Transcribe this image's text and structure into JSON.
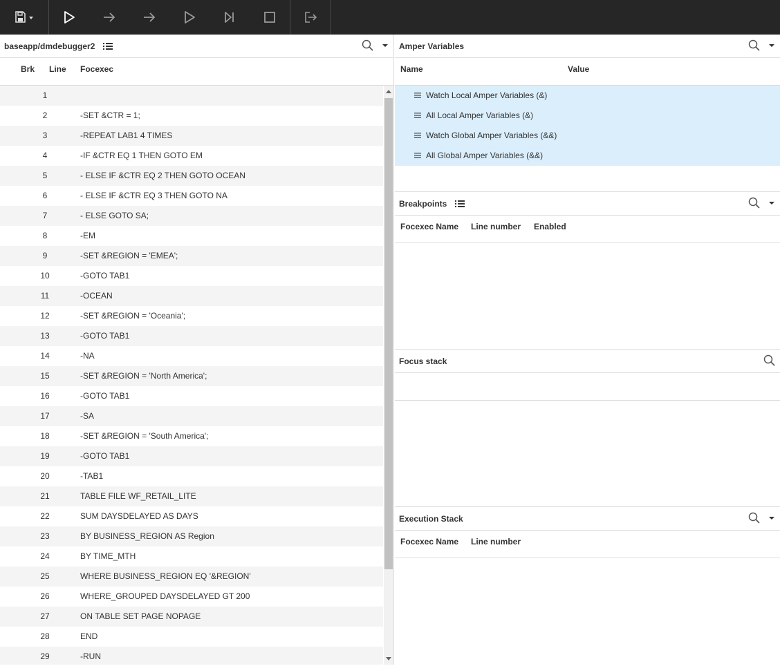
{
  "toolbar": {
    "buttons": [
      {
        "icon": "save-dropdown-icon"
      },
      {
        "icon": "run-icon"
      },
      {
        "icon": "step-icon"
      },
      {
        "icon": "step-over-icon"
      },
      {
        "icon": "continue-icon"
      },
      {
        "icon": "run-to-end-icon"
      },
      {
        "icon": "stop-icon"
      },
      {
        "icon": "exit-icon"
      }
    ]
  },
  "editor": {
    "path": "baseapp/dmdebugger2",
    "columns": {
      "brk": "Brk",
      "line": "Line",
      "focexec": "Focexec"
    },
    "lines": [
      {
        "n": "1",
        "t": ""
      },
      {
        "n": "2",
        "t": "-SET &CTR = 1;"
      },
      {
        "n": "3",
        "t": "-REPEAT LAB1 4 TIMES"
      },
      {
        "n": "4",
        "t": "-IF &CTR EQ 1 THEN GOTO EM"
      },
      {
        "n": "5",
        "t": "- ELSE IF &CTR EQ 2 THEN GOTO OCEAN"
      },
      {
        "n": "6",
        "t": "- ELSE IF &CTR EQ 3 THEN GOTO NA"
      },
      {
        "n": "7",
        "t": "- ELSE GOTO SA;"
      },
      {
        "n": "8",
        "t": "-EM"
      },
      {
        "n": "9",
        "t": "-SET &REGION = 'EMEA';"
      },
      {
        "n": "10",
        "t": "-GOTO TAB1"
      },
      {
        "n": "11",
        "t": "-OCEAN"
      },
      {
        "n": "12",
        "t": "-SET &REGION = 'Oceania';"
      },
      {
        "n": "13",
        "t": "-GOTO TAB1"
      },
      {
        "n": "14",
        "t": "-NA"
      },
      {
        "n": "15",
        "t": "-SET &REGION = 'North America';"
      },
      {
        "n": "16",
        "t": "-GOTO TAB1"
      },
      {
        "n": "17",
        "t": "-SA"
      },
      {
        "n": "18",
        "t": "-SET &REGION = 'South America';"
      },
      {
        "n": "19",
        "t": "-GOTO TAB1"
      },
      {
        "n": "20",
        "t": "-TAB1"
      },
      {
        "n": "21",
        "t": "TABLE FILE WF_RETAIL_LITE"
      },
      {
        "n": "22",
        "t": "SUM DAYSDELAYED AS DAYS"
      },
      {
        "n": "23",
        "t": "BY BUSINESS_REGION AS Region"
      },
      {
        "n": "24",
        "t": "BY TIME_MTH"
      },
      {
        "n": "25",
        "t": "WHERE BUSINESS_REGION EQ '&REGION'"
      },
      {
        "n": "26",
        "t": "WHERE_GROUPED DAYSDELAYED GT 200"
      },
      {
        "n": "27",
        "t": "ON TABLE SET PAGE NOPAGE"
      },
      {
        "n": "28",
        "t": "END"
      },
      {
        "n": "29",
        "t": "-RUN"
      }
    ]
  },
  "amper": {
    "title": "Amper Variables",
    "columns": {
      "name": "Name",
      "value": "Value"
    },
    "items": [
      "Watch Local Amper Variables (&)",
      "All Local Amper Variables (&)",
      "Watch Global Amper Variables (&&)",
      "All Global Amper Variables (&&)"
    ]
  },
  "breakpoints": {
    "title": "Breakpoints",
    "columns": {
      "focexec_name": "Focexec Name",
      "line_number": "Line number",
      "enabled": "Enabled"
    }
  },
  "focus_stack": {
    "title": "Focus stack"
  },
  "execution_stack": {
    "title": "Execution Stack",
    "columns": {
      "focexec_name": "Focexec Name",
      "line_number": "Line number"
    }
  },
  "colors": {
    "toolbar_bg": "#262626",
    "selection_bg": "#dbeefb",
    "row_alt": "#f4f4f4"
  }
}
